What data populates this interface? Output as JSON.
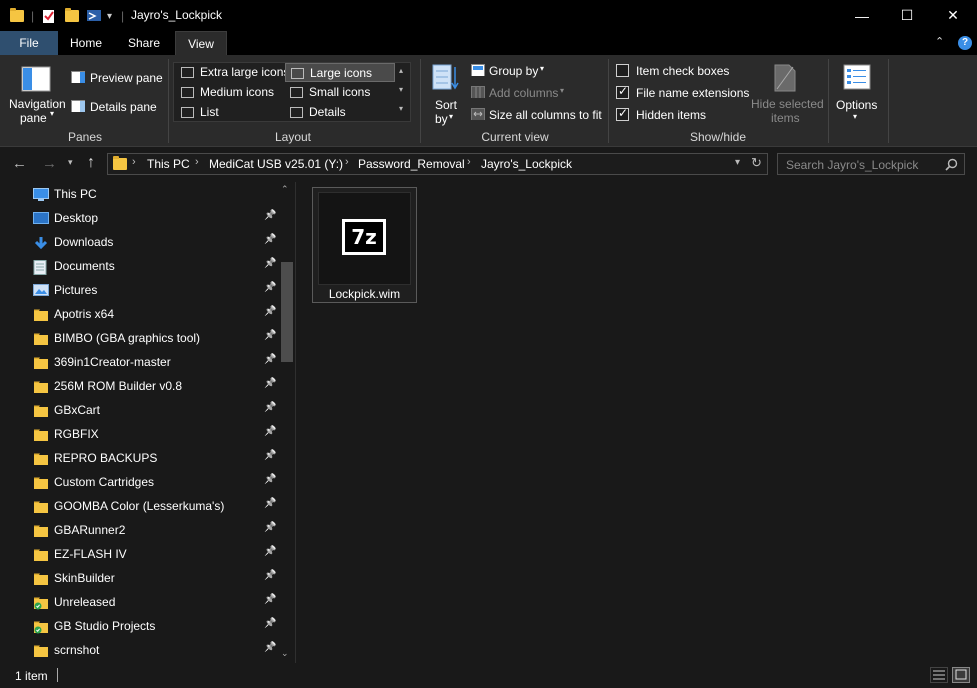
{
  "window": {
    "title": "Jayro's_Lockpick",
    "minimize": "—",
    "maximize": "☐",
    "close": "✕"
  },
  "quick_access": {
    "dropdown": "▾",
    "separator": "|"
  },
  "tabs": [
    {
      "label": "File"
    },
    {
      "label": "Home"
    },
    {
      "label": "Share"
    },
    {
      "label": "View"
    }
  ],
  "ribbon": {
    "panes": {
      "navigation_pane_line1": "Navigation",
      "navigation_pane_line2": "pane",
      "preview_pane": "Preview pane",
      "details_pane": "Details pane",
      "group": "Panes"
    },
    "layout": {
      "items": [
        "Extra large icons",
        "Large icons",
        "Medium icons",
        "Small icons",
        "List",
        "Details"
      ],
      "selected": "Large icons",
      "group": "Layout"
    },
    "current_view": {
      "sort_line1": "Sort",
      "sort_line2": "by",
      "group_by": "Group by",
      "add_columns": "Add columns",
      "size_all": "Size all columns to fit",
      "group": "Current view"
    },
    "show_hide": {
      "item_check_boxes": "Item check boxes",
      "item_check_boxes_checked": false,
      "file_name_extensions": "File name extensions",
      "file_name_extensions_checked": true,
      "hidden_items": "Hidden items",
      "hidden_items_checked": true,
      "hide_selected_line1": "Hide selected",
      "hide_selected_line2": "items",
      "group": "Show/hide"
    },
    "options": "Options"
  },
  "address": {
    "crumbs": [
      "This PC",
      "MediCat USB v25.01 (Y:)",
      "Password_Removal",
      "Jayro's_Lockpick"
    ],
    "search_placeholder": "Search Jayro's_Lockpick"
  },
  "nav_pane": {
    "items": [
      {
        "label": "This PC",
        "icon": "monitor-icon"
      },
      {
        "label": "Desktop",
        "icon": "desktop-icon"
      },
      {
        "label": "Downloads",
        "icon": "download-icon"
      },
      {
        "label": "Documents",
        "icon": "document-icon"
      },
      {
        "label": "Pictures",
        "icon": "pictures-icon"
      },
      {
        "label": "Apotris x64",
        "icon": "folder-icon"
      },
      {
        "label": "BIMBO (GBA graphics tool)",
        "icon": "folder-icon"
      },
      {
        "label": "369in1Creator-master",
        "icon": "folder-icon"
      },
      {
        "label": "256M ROM Builder v0.8",
        "icon": "folder-icon"
      },
      {
        "label": "GBxCart",
        "icon": "folder-icon"
      },
      {
        "label": "RGBFIX",
        "icon": "folder-icon"
      },
      {
        "label": "REPRO BACKUPS",
        "icon": "folder-icon"
      },
      {
        "label": "Custom Cartridges",
        "icon": "folder-icon"
      },
      {
        "label": "GOOMBA Color (Lesserkuma's)",
        "icon": "folder-icon"
      },
      {
        "label": "GBARunner2",
        "icon": "folder-icon"
      },
      {
        "label": "EZ-FLASH IV",
        "icon": "folder-icon"
      },
      {
        "label": "SkinBuilder",
        "icon": "folder-icon"
      },
      {
        "label": "Unreleased",
        "icon": "folder-sync-icon"
      },
      {
        "label": "GB Studio Projects",
        "icon": "folder-sync-icon"
      },
      {
        "label": "scrnshot",
        "icon": "folder-icon"
      }
    ]
  },
  "content": {
    "files": [
      {
        "name": "Lockpick.wim",
        "icon": "7z-icon",
        "icon_text": "7z"
      }
    ]
  },
  "status": {
    "count": "1 item"
  },
  "colors": {
    "folder": "#f5c542",
    "file_tab": "#2f4f6f",
    "accent_blue": "#3a8ee6"
  }
}
